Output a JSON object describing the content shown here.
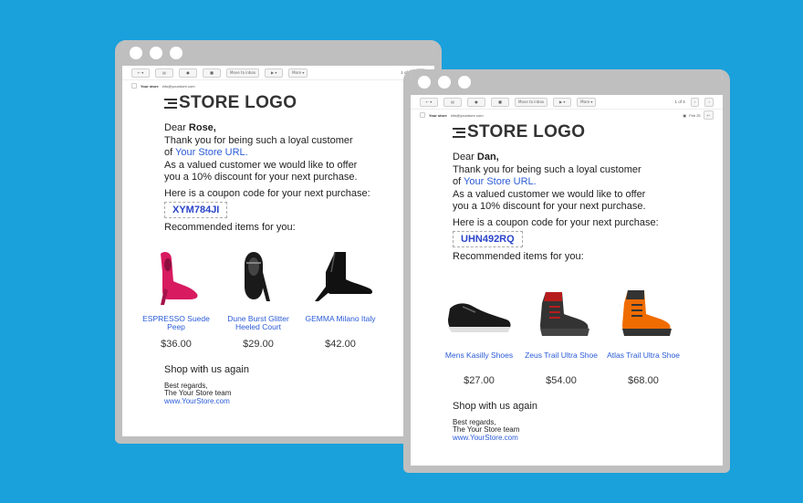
{
  "toolbar": {
    "back": "← ▾",
    "archive": "▤",
    "spam": "●",
    "trash": "■",
    "move": "Move to inbox",
    "labels": "▶ ▾",
    "more": "More ▾",
    "pager": "1 of 4",
    "prev": "‹",
    "next": "›"
  },
  "sender": {
    "name": "Your store",
    "email": "info@yourstore.com",
    "date": "Feb 25"
  },
  "emails": [
    {
      "logo": "STORE LOGO",
      "greeting_prefix": "Dear ",
      "customer": "Rose,",
      "line1": "Thank you for being such a loyal customer",
      "line2_prefix": "of ",
      "store_url": "Your Store URL.",
      "line3": "As a valued customer we would like to offer",
      "line4": "you a 10% discount for your next purchase.",
      "coupon_label": "Here is a coupon code for your next purchase:",
      "coupon_code": "XYM784JI",
      "recommended": "Recommended items for you:",
      "products": [
        {
          "name": "ESPRESSO Suede Peep",
          "price": "$36.00",
          "icon": "pink-heel-shoe-icon",
          "color": "#d81b60"
        },
        {
          "name": "Dune Burst Glitter Heeled Court",
          "price": "$29.00",
          "icon": "black-heel-shoe-icon",
          "color": "#1a1a1a"
        },
        {
          "name": "GEMMA Milano Italy",
          "price": "$42.00",
          "icon": "black-ankle-boot-icon",
          "color": "#111111"
        }
      ],
      "shop_again": "Shop with us again",
      "regards": "Best regards,",
      "team": "The Your Store team",
      "site": "www.YourStore.com"
    },
    {
      "logo": "STORE LOGO",
      "greeting_prefix": "Dear ",
      "customer": "Dan,",
      "line1": "Thank you for being such a loyal customer",
      "line2_prefix": "of ",
      "store_url": "Your Store URL.",
      "line3": "As a valued customer we would like to offer",
      "line4": "you a 10% discount for your next purchase.",
      "coupon_label": "Here is a coupon code for your next purchase:",
      "coupon_code": "UHN492RQ",
      "recommended": "Recommended items for you:",
      "products": [
        {
          "name": "Mens Kasilly Shoes",
          "price": "$27.00",
          "icon": "black-sneaker-icon",
          "color": "#1a1a1a"
        },
        {
          "name": "Zeus Trail Ultra Shoe",
          "price": "$54.00",
          "icon": "red-hiking-boot-icon",
          "color": "#b71c1c"
        },
        {
          "name": "Atlas Trail Ultra Shoe",
          "price": "$68.00",
          "icon": "orange-hiking-boot-icon",
          "color": "#ef6c00"
        }
      ],
      "shop_again": "Shop with us again",
      "regards": "Best regards,",
      "team": "The Your Store team",
      "site": "www.YourStore.com"
    }
  ]
}
